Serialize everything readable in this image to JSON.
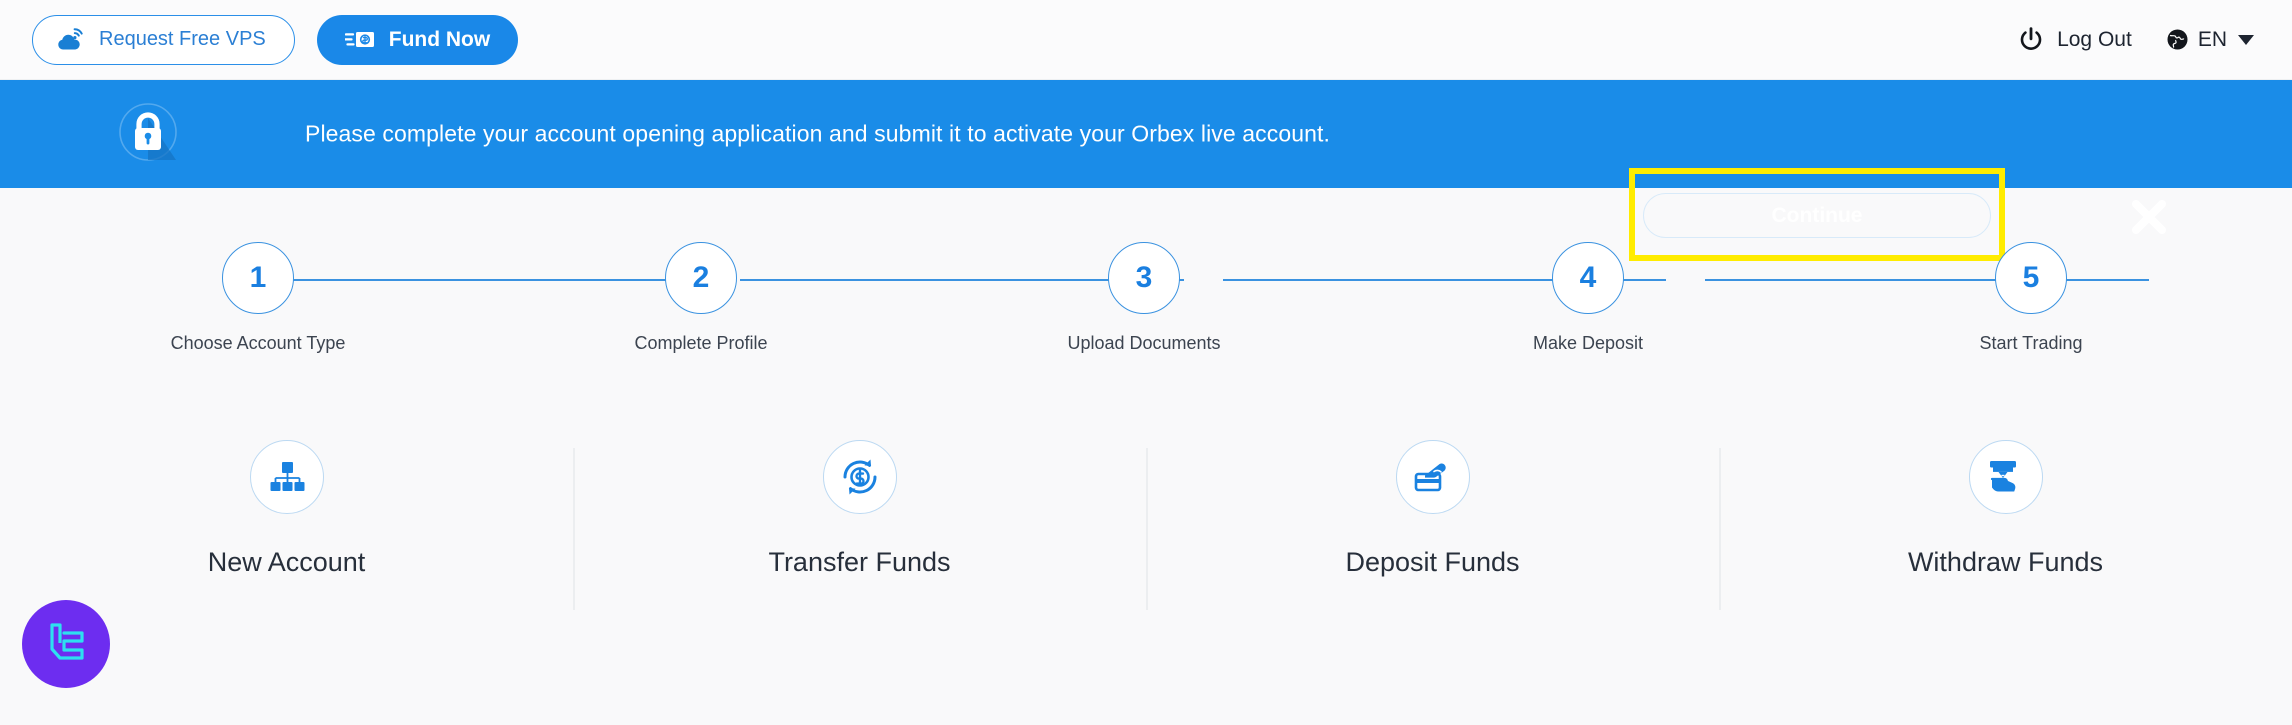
{
  "header": {
    "vps_button": {
      "label": "Request Free VPS",
      "icon": "cloud-wifi-icon"
    },
    "fund_button": {
      "label": "Fund Now",
      "icon": "cash-money-icon"
    },
    "logout": {
      "label": "Log Out",
      "icon": "power-icon"
    },
    "language": {
      "label": "EN",
      "icon": "globe-icon",
      "caret": "chevron-down-icon"
    }
  },
  "banner": {
    "icon": "lock-icon",
    "message": "Please complete your account opening application and submit it to activate your Orbex live account.",
    "continue_label": "Continue",
    "close_icon": "close-icon",
    "background_color": "#1a8ce8",
    "highlight_color": "#ffec00"
  },
  "stepper": {
    "accent_color": "#3a92e0",
    "steps": [
      {
        "number": "1",
        "label": "Choose Account Type"
      },
      {
        "number": "2",
        "label": "Complete Profile"
      },
      {
        "number": "3",
        "label": "Upload Documents"
      },
      {
        "number": "4",
        "label": "Make Deposit"
      },
      {
        "number": "5",
        "label": "Start Trading"
      }
    ]
  },
  "quick_actions": [
    {
      "label": "New Account",
      "icon": "org-chart-icon"
    },
    {
      "label": "Transfer Funds",
      "icon": "dollar-refresh-icon"
    },
    {
      "label": "Deposit Funds",
      "icon": "hand-card-icon"
    },
    {
      "label": "Withdraw Funds",
      "icon": "atm-cash-hand-icon"
    }
  ],
  "widget": {
    "icon": "lc-monogram-icon",
    "background_color": "#6d2df0",
    "glyph_color": "#2de0f0"
  }
}
